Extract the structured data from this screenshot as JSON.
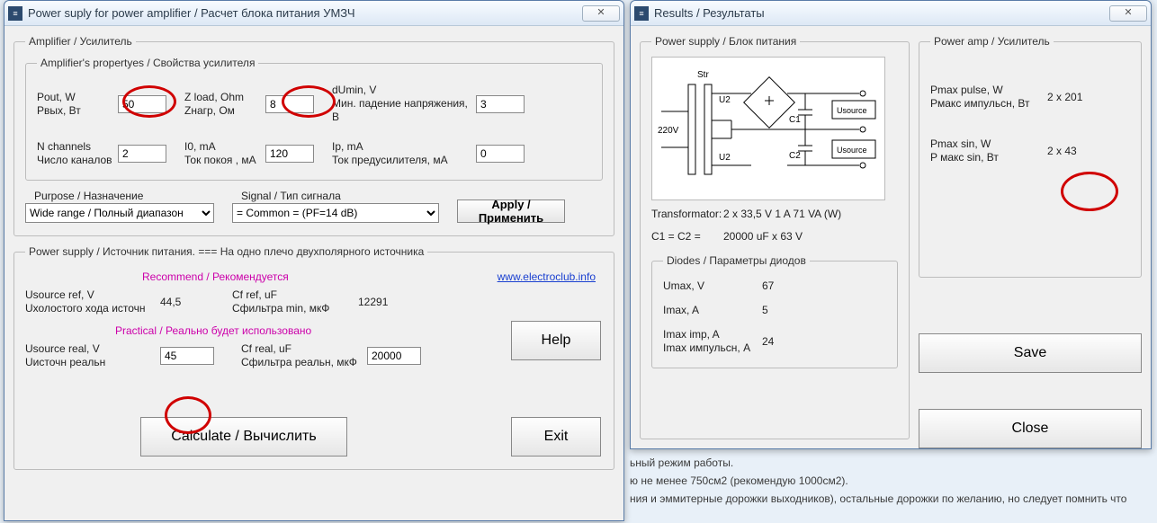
{
  "bg": {
    "l1": "ьный режим работы.",
    "l2": "ю не менее 750см2 (рекомендую 1000см2).",
    "l3": "ния и эммитерные дорожки выходников), остальные дорожки по желанию, но следует помнить что"
  },
  "win1": {
    "title": "Power suply for power amplifier / Расчет блока питания УМЗЧ",
    "amp_legend": "Amplifier / Усилитель",
    "props_legend": "Amplifier's propertyes / Свойства усилителя",
    "pout_l1": "Pout, W",
    "pout_l2": "Pвых, Вт",
    "pout_v": "50",
    "zload_l1": "Z load, Ohm",
    "zload_l2": "Zнагр, Ом",
    "zload_v": "8",
    "dumin_l1": "dUmin, V",
    "dumin_l2": "Мин. падение напряжения, В",
    "dumin_v": "3",
    "nch_l1": "N channels",
    "nch_l2": "Число каналов",
    "nch_v": "2",
    "i0_l1": "I0, mA",
    "i0_l2": "Ток покоя , мА",
    "i0_v": "120",
    "ip_l1": "Ip, mA",
    "ip_l2": "Ток предусилителя, мА",
    "ip_v": "0",
    "purpose_lbl": "Purpose / Назначение",
    "purpose_v": "Wide range / Полный диапазон",
    "signal_lbl": "Signal / Тип сигнала",
    "signal_v": "= Common =    (PF=14 dB)",
    "apply": "Apply / Применить",
    "ps_legend": "Power supply / Источник питания. ===  На одно плечо двухполярного источника",
    "link": "www.electroclub.info",
    "rec": "Recommend / Рекомендуется",
    "usrc_ref_l1": "Usource ref, V",
    "usrc_ref_l2": "Uхолостого хода источн",
    "usrc_ref_v": "44,5",
    "cfref_l1": "Cf ref, uF",
    "cfref_l2": "Cфильтра min, мкФ",
    "cfref_v": "12291",
    "prac": "Practical / Реально будет использовано",
    "usrc_real_l1": "Usource real, V",
    "usrc_real_l2": "Uисточн реальн",
    "usrc_real_v": "45",
    "cfreal_l1": "Cf real, uF",
    "cfreal_l2": "Cфильтра реальн, мкФ",
    "cfreal_v": "20000",
    "calculate": "Calculate / Вычислить",
    "help": "Help",
    "exit": "Exit"
  },
  "win2": {
    "title": "Results / Результаты",
    "ps_legend": "Power supply / Блок питания",
    "trans_lbl": "Transformator:",
    "trans_v": "2 x 33,5 V   1 A    71 VA (W)",
    "c_lbl": "C1 = C2 =",
    "c_v": "20000 uF   x  63 V",
    "diodes_legend": "Diodes / Параметры диодов",
    "umax_l": "Umax, V",
    "umax_v": "67",
    "imax_l": "Imax, A",
    "imax_v": "5",
    "iimp_l1": "Imax imp, A",
    "iimp_l2": "Imax импульсн, А",
    "iimp_v": "24",
    "pa_legend": "Power amp / Усилитель",
    "ppulse_l1": "Pmax pulse, W",
    "ppulse_l2": "Pмакс импульсн, Вт",
    "ppulse_v": "2 x 201",
    "psin_l1": "Pmax sin, W",
    "psin_l2": "P макс sin, Вт",
    "psin_v": "2 x 43",
    "save": "Save",
    "close": "Close"
  },
  "schematic": {
    "str": "Str",
    "v220": "220V",
    "u2a": "U2",
    "u2b": "U2",
    "c1": "C1",
    "c2": "C2",
    "us1": "Usource",
    "us2": "Usource"
  }
}
